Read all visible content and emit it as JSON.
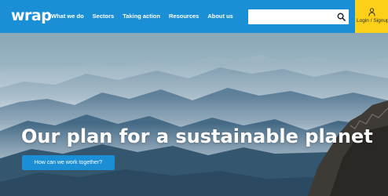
{
  "header": {
    "logo": "wrap",
    "nav": [
      "What we do",
      "Sectors",
      "Taking action",
      "Resources",
      "About us"
    ],
    "search": {
      "value": "",
      "placeholder": "",
      "icon": "search-icon"
    },
    "login": {
      "label": "Login / Signup",
      "icon": "user-icon"
    },
    "colors": {
      "brand_blue": "#1b8fd6",
      "login_yellow": "#fcd018"
    }
  },
  "hero": {
    "title": "Our plan for a sustainable planet",
    "cta_label": "How can we work together?",
    "image": "misty-mountain-ranges"
  }
}
